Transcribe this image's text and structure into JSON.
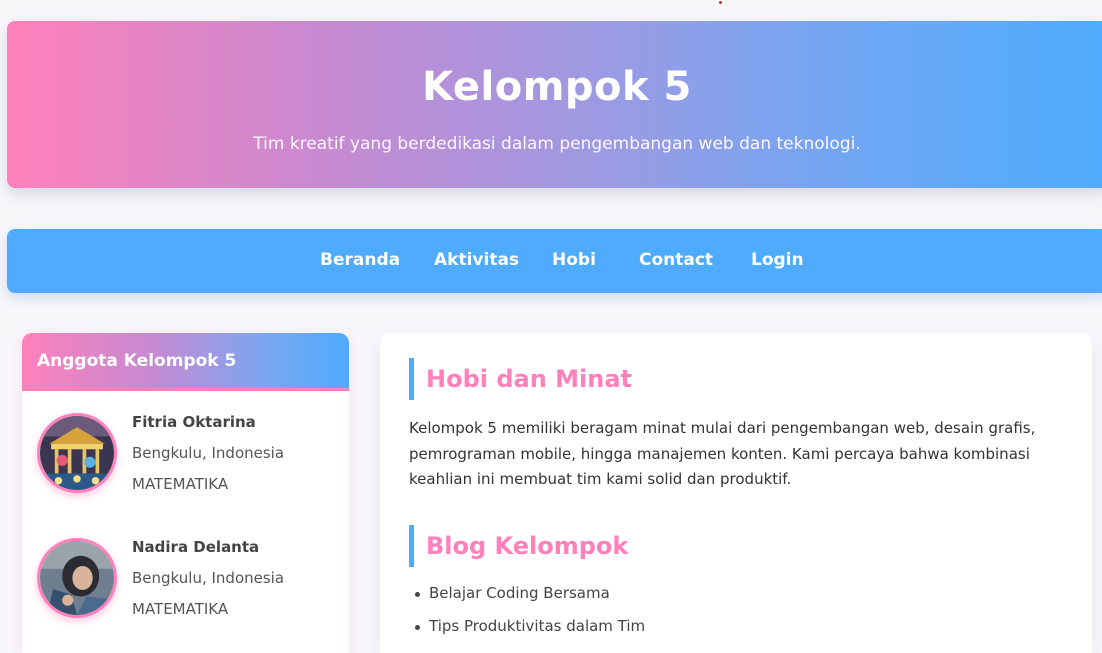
{
  "header": {
    "title": "Kelompok 5",
    "subtitle": "Tim kreatif yang berdedikasi dalam pengembangan web dan teknologi."
  },
  "nav": {
    "items": [
      {
        "label": "Beranda"
      },
      {
        "label": "Aktivitas"
      },
      {
        "label": "Hobi"
      },
      {
        "label": "Contact"
      },
      {
        "label": "Login"
      }
    ]
  },
  "sidebar": {
    "title": "Anggota Kelompok 5",
    "members": [
      {
        "name": "Fitria Oktarina",
        "location": "Bengkulu, Indonesia",
        "major": "MATEMATIKA",
        "avatar_icon": "carousel-photo"
      },
      {
        "name": "Nadira Delanta",
        "location": "Bengkulu, Indonesia",
        "major": "MATEMATIKA",
        "avatar_icon": "portrait-photo"
      }
    ]
  },
  "main": {
    "hobbies": {
      "title": "Hobi dan Minat",
      "text": "Kelompok 5 memiliki beragam minat mulai dari pengembangan web, desain grafis, pemrograman mobile, hingga manajemen konten. Kami percaya bahwa kombinasi keahlian ini membuat tim kami solid dan produktif."
    },
    "blog": {
      "title": "Blog Kelompok",
      "items": [
        {
          "label": "Belajar Coding Bersama"
        },
        {
          "label": "Tips Produktivitas dalam Tim"
        }
      ]
    }
  },
  "colors": {
    "pink": "#ff80bb",
    "blue": "#4eabfd",
    "background": "#f7f7fa"
  }
}
